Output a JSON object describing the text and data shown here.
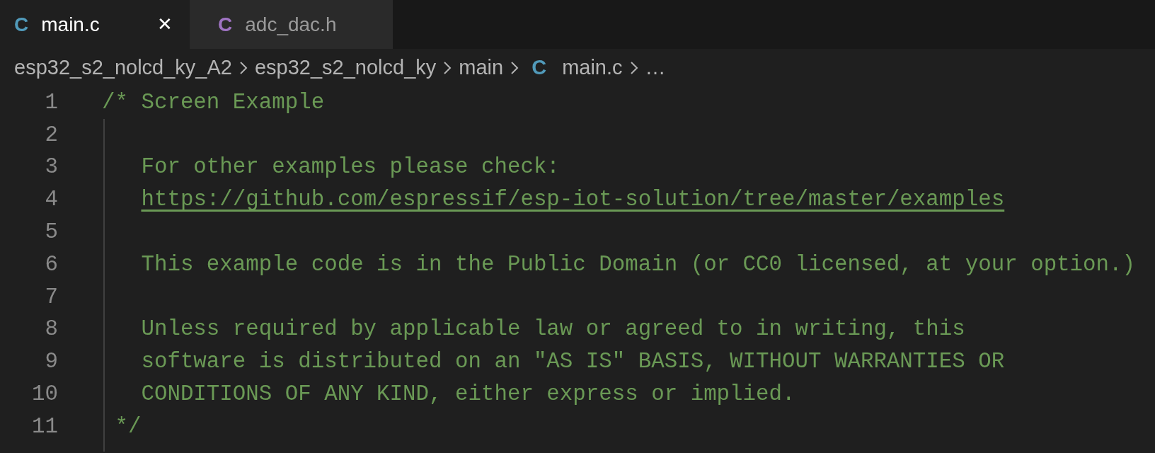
{
  "tabs": [
    {
      "icon": "C",
      "color": "#519aba",
      "label": "main.c",
      "selected": true,
      "close": "✕"
    },
    {
      "icon": "C",
      "color": "#a074c4",
      "label": "adc_dac.h",
      "selected": false
    }
  ],
  "breadcrumb": [
    {
      "label": "esp32_s2_nolcd_ky_A2"
    },
    {
      "label": "esp32_s2_nolcd_ky"
    },
    {
      "label": "main"
    },
    {
      "icon": "C",
      "color": "#519aba",
      "label": "main.c"
    },
    {
      "label": "…"
    }
  ],
  "lines": [
    {
      "number": "1",
      "text": "/* Screen Example",
      "kind": "comment"
    },
    {
      "number": "2"
    },
    {
      "number": "3",
      "text": "   For other examples please check:",
      "kind": "comment"
    },
    {
      "number": "4",
      "text": "   https://github.com/espressif/esp-iot-solution/tree/master/examples",
      "kind": "link"
    },
    {
      "number": "5"
    },
    {
      "number": "6",
      "text": "   This example code is in the Public Domain (or CC0 licensed, at your option.)",
      "kind": "comment"
    },
    {
      "number": "7"
    },
    {
      "number": "8",
      "text": "   Unless required by applicable law or agreed to in writing, this",
      "kind": "comment"
    },
    {
      "number": "9",
      "text": "   software is distributed on an \"AS IS\" BASIS, WITHOUT WARRANTIES OR",
      "kind": "comment"
    },
    {
      "number": "10",
      "text": "   CONDITIONS OF ANY KIND, either express or implied.",
      "kind": "comment"
    },
    {
      "number": "11",
      "text": " */",
      "kind": "comment"
    }
  ]
}
